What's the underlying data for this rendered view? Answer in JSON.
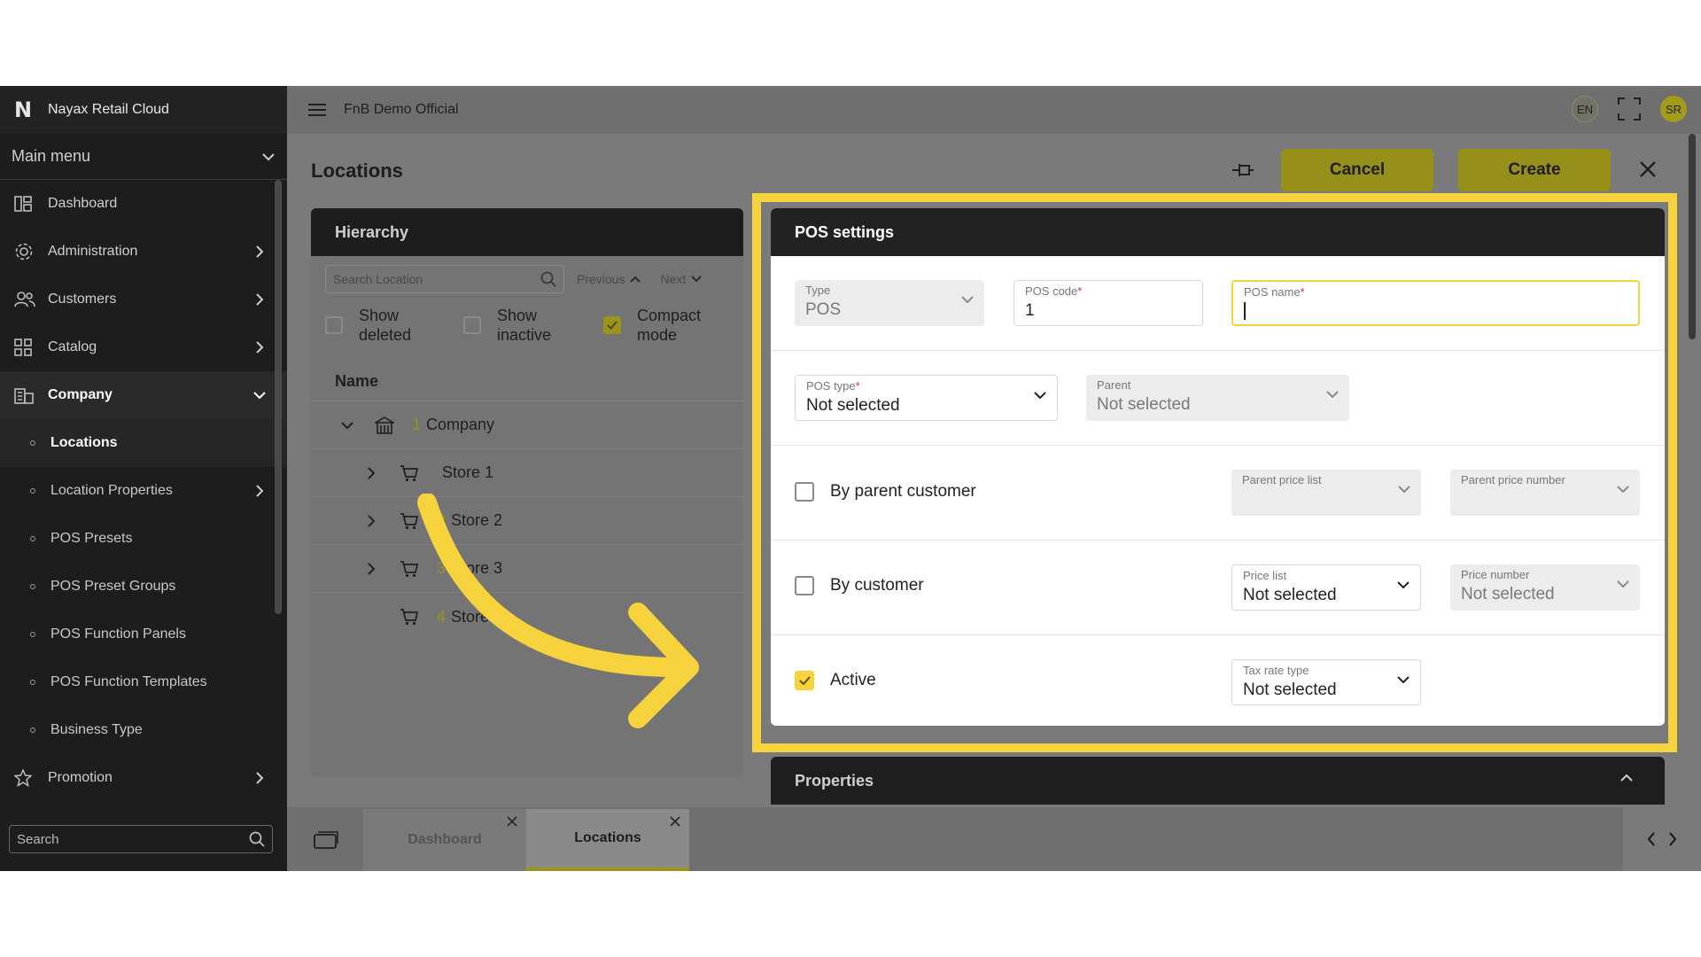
{
  "app": {
    "brand_logo": "N",
    "brand_name": "Nayax Retail Cloud",
    "org_name": "FnB Demo Official",
    "lang": "EN",
    "user_initials": "SR"
  },
  "sidebar": {
    "main_menu": "Main menu",
    "items": [
      {
        "label": "Dashboard",
        "icon": "dashboard-icon"
      },
      {
        "label": "Administration",
        "icon": "gear-icon"
      },
      {
        "label": "Customers",
        "icon": "users-icon"
      },
      {
        "label": "Catalog",
        "icon": "grid-icon"
      },
      {
        "label": "Company",
        "icon": "building-icon"
      },
      {
        "label": "Locations"
      },
      {
        "label": "Location Properties"
      },
      {
        "label": "POS Presets"
      },
      {
        "label": "POS Preset Groups"
      },
      {
        "label": "POS Function Panels"
      },
      {
        "label": "POS Function Templates"
      },
      {
        "label": "Business Type"
      },
      {
        "label": "Promotion",
        "icon": "star-icon"
      }
    ],
    "search_placeholder": "Search"
  },
  "page": {
    "title": "Locations",
    "cancel_label": "Cancel",
    "create_label": "Create"
  },
  "hierarchy": {
    "title": "Hierarchy",
    "search_placeholder": "Search Location",
    "previous": "Previous",
    "next": "Next",
    "show_deleted": "Show\ndeleted",
    "show_inactive": "Show\ninactive",
    "compact_mode": "Compact\nmode",
    "name_header": "Name",
    "tree": [
      {
        "num": "1",
        "name": "Company"
      },
      {
        "num": "",
        "name": "Store 1"
      },
      {
        "num": "2",
        "name": "Store 2"
      },
      {
        "num": "3",
        "name": "Store 3"
      },
      {
        "num": "4",
        "name": "Store 4"
      }
    ]
  },
  "pos_settings": {
    "title": "POS settings",
    "type_label": "Type",
    "type_value": "POS",
    "pos_code_label": "POS code",
    "pos_code_value": "1",
    "pos_name_label": "POS name",
    "pos_name_value": "",
    "pos_type_label": "POS type",
    "pos_type_value": "Not selected",
    "parent_label": "Parent",
    "parent_value": "Not selected",
    "by_parent_customer": "By parent customer",
    "parent_price_list_label": "Parent price list",
    "parent_price_number_label": "Parent price number",
    "by_customer": "By customer",
    "price_list_label": "Price list",
    "price_list_value": "Not selected",
    "price_number_label": "Price number",
    "price_number_value": "Not selected",
    "active": "Active",
    "active_checked": true,
    "tax_rate_type_label": "Tax rate type",
    "tax_rate_type_value": "Not selected",
    "required_mark": "*"
  },
  "properties": {
    "title": "Properties"
  },
  "tabs": [
    {
      "label": "Dashboard"
    },
    {
      "label": "Locations"
    }
  ],
  "colors": {
    "accent": "#f6d23c",
    "dark": "#1d1d1d"
  }
}
